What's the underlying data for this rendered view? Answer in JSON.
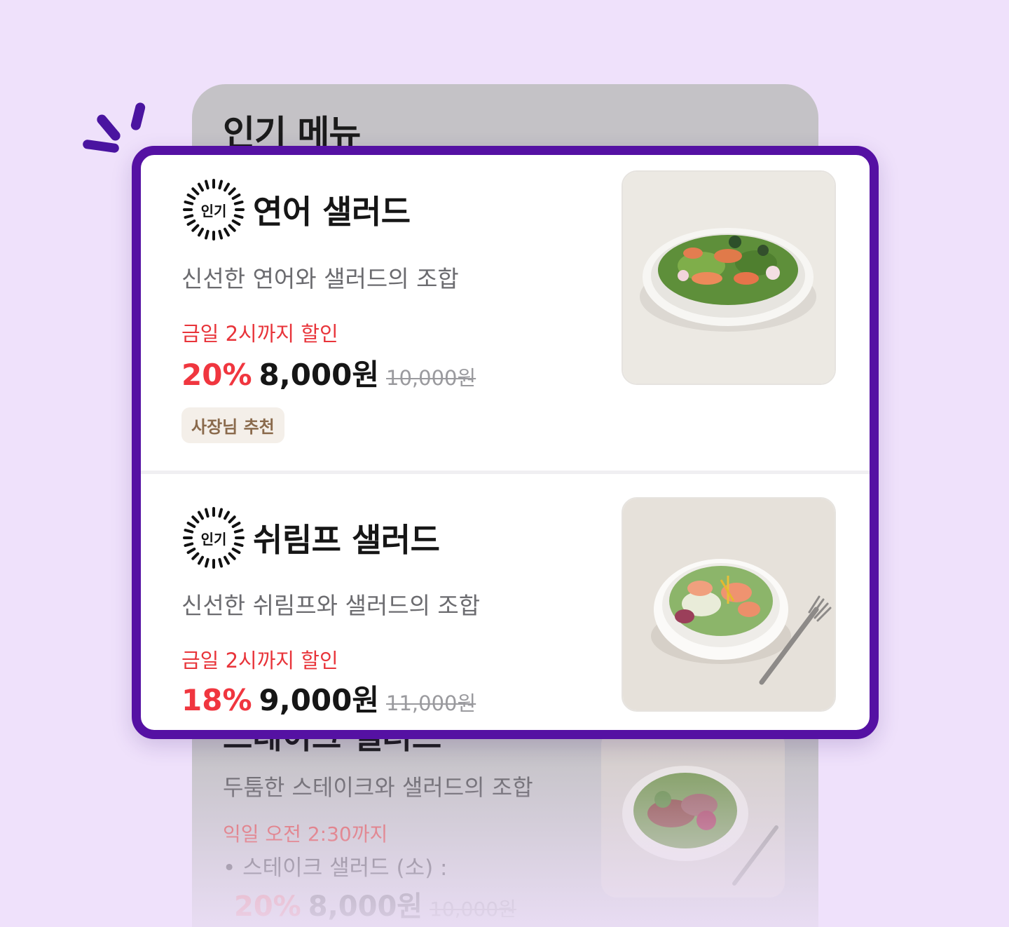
{
  "background_list": {
    "title": "인기 메뉴",
    "item": {
      "name": "스테이크 샐러드",
      "description": "두툼한 스테이크와 샐러드의 조합",
      "deadline": "익일 오전 2:30까지",
      "option": "• 스테이크 샐러드 (소) :",
      "discount": "20%",
      "price": "8,000원",
      "original_price": "10,000원"
    }
  },
  "popular_items": [
    {
      "badge": "인기",
      "name": "연어 샐러드",
      "description": "신선한 연어와 샐러드의 조합",
      "deal_label": "금일 2시까지 할인",
      "discount": "20%",
      "price": "8,000원",
      "original_price": "10,000원",
      "tag": "사장님 추천",
      "photo": "salmon-salad-photo"
    },
    {
      "badge": "인기",
      "name": "쉬림프 샐러드",
      "description": "신선한 쉬림프와 샐러드의 조합",
      "deal_label": "금일 2시까지 할인",
      "discount": "18%",
      "price": "9,000원",
      "original_price": "11,000원",
      "photo": "shrimp-salad-photo"
    }
  ],
  "colors": {
    "page_background": "#efe1fb",
    "highlight_border": "#5511a3",
    "discount_red": "#f0363f",
    "tag_brown": "#8a6a4c"
  }
}
